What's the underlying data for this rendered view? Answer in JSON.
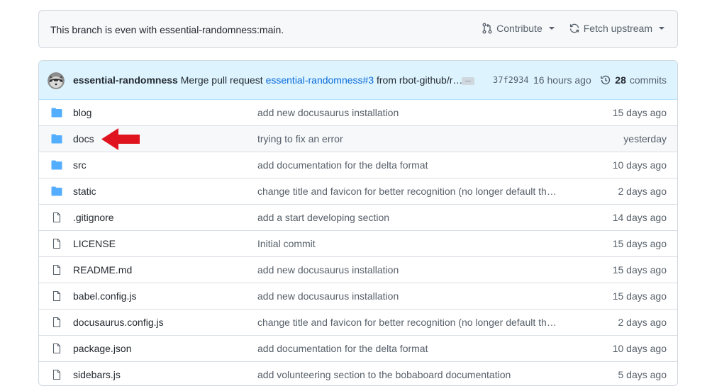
{
  "branch": {
    "status_text": "This branch is even with essential-randomness:main.",
    "contribute_label": "Contribute",
    "fetch_label": "Fetch upstream"
  },
  "latest_commit": {
    "author": "essential-randomness",
    "message_prefix": "Merge pull request",
    "pr_link": "essential-randomness#3",
    "message_suffix": "from rbot-github/r…",
    "ellipsis": "…",
    "sha": "37f2934",
    "time": "16 hours ago",
    "commits_count": "28",
    "commits_label": "commits"
  },
  "files": [
    {
      "name": "blog",
      "type": "folder",
      "message": "add new docusaurus installation",
      "age": "15 days ago"
    },
    {
      "name": "docs",
      "type": "folder",
      "message": "trying to fix an error",
      "age": "yesterday"
    },
    {
      "name": "src",
      "type": "folder",
      "message": "add documentation for the delta format",
      "age": "10 days ago"
    },
    {
      "name": "static",
      "type": "folder",
      "message": "change title and favicon for better recognition (no longer default th…",
      "age": "2 days ago"
    },
    {
      "name": ".gitignore",
      "type": "file",
      "message": "add a start developing section",
      "age": "14 days ago"
    },
    {
      "name": "LICENSE",
      "type": "file",
      "message": "Initial commit",
      "age": "15 days ago"
    },
    {
      "name": "README.md",
      "type": "file",
      "message": "add new docusaurus installation",
      "age": "15 days ago"
    },
    {
      "name": "babel.config.js",
      "type": "file",
      "message": "add new docusaurus installation",
      "age": "15 days ago"
    },
    {
      "name": "docusaurus.config.js",
      "type": "file",
      "message": "change title and favicon for better recognition (no longer default th…",
      "age": "2 days ago"
    },
    {
      "name": "package.json",
      "type": "file",
      "message": "add documentation for the delta format",
      "age": "10 days ago"
    },
    {
      "name": "sidebars.js",
      "type": "file",
      "message": "add volunteering section to the bobaboard documentation",
      "age": "5 days ago"
    }
  ],
  "colors": {
    "folder": "#54aeff",
    "file_outline": "#57606a",
    "link": "#0969da",
    "annotation_arrow": "#e0141e"
  },
  "icons": {
    "contribute": "git-pull-request-icon",
    "fetch": "sync-icon",
    "history": "history-icon",
    "folder": "folder-icon",
    "file": "file-icon"
  }
}
